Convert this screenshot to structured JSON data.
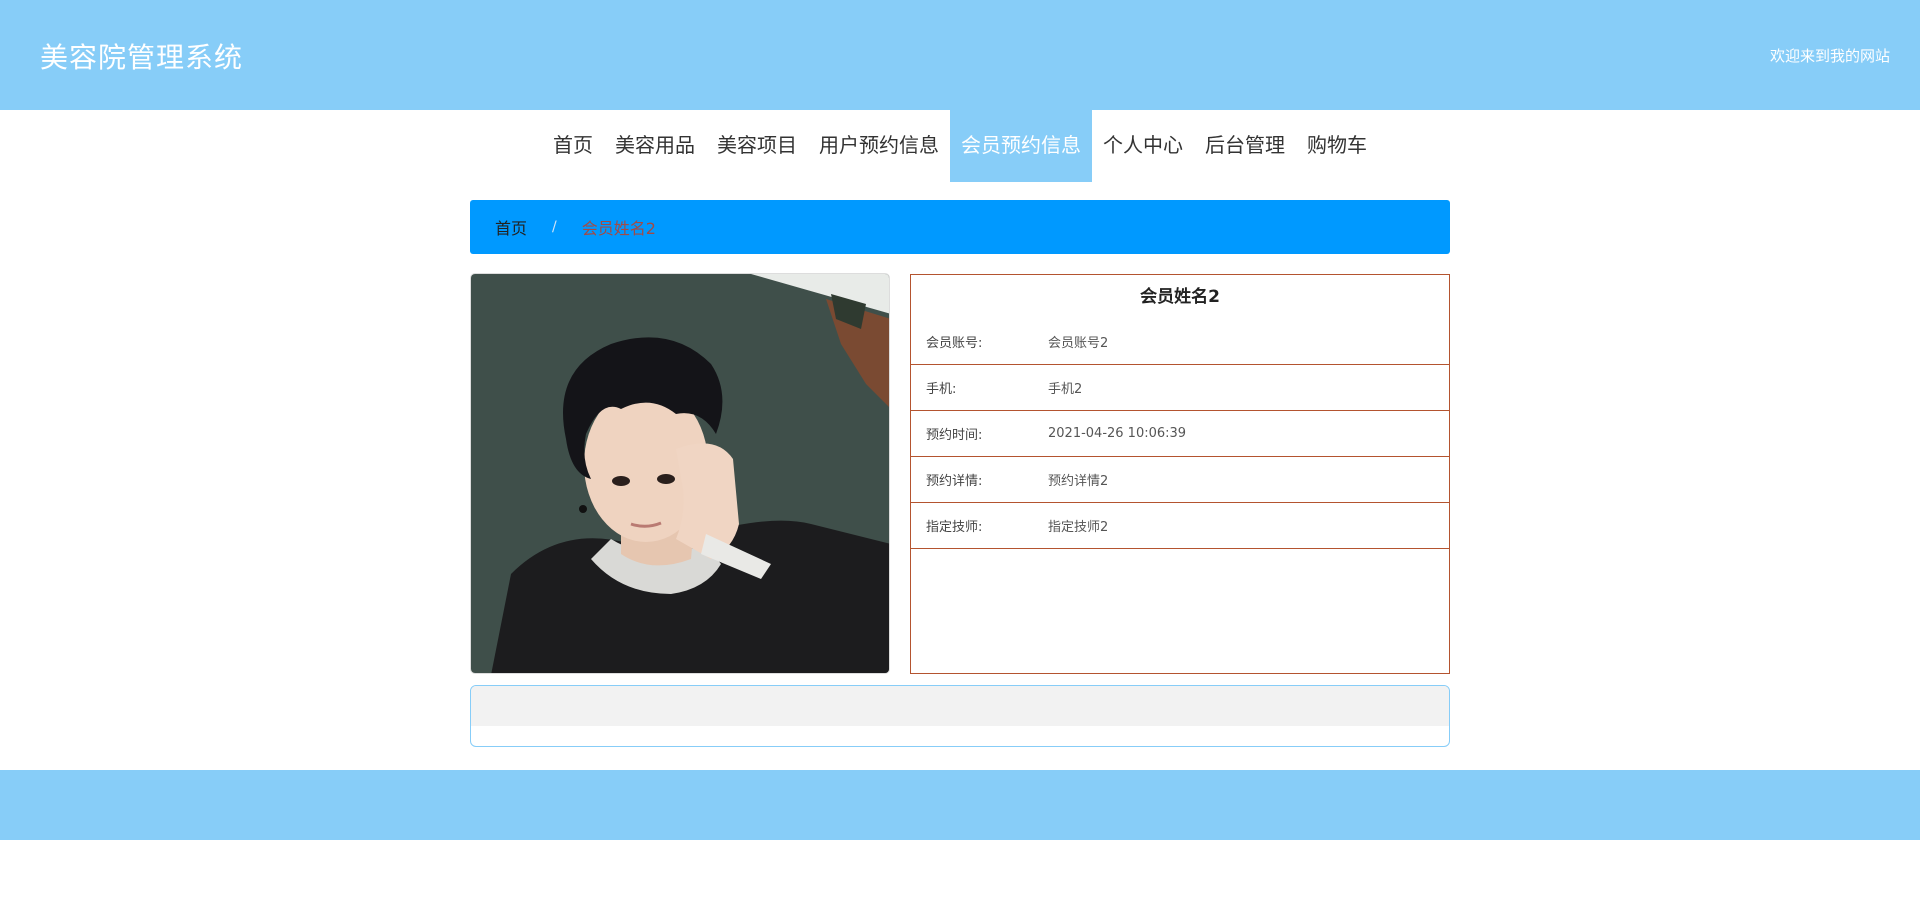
{
  "header": {
    "title": "美容院管理系统",
    "welcome": "欢迎来到我的网站"
  },
  "nav": {
    "items": [
      {
        "label": "首页"
      },
      {
        "label": "美容用品"
      },
      {
        "label": "美容项目"
      },
      {
        "label": "用户预约信息"
      },
      {
        "label": "会员预约信息",
        "active": true
      },
      {
        "label": "个人中心"
      },
      {
        "label": "后台管理"
      },
      {
        "label": "购物车"
      }
    ]
  },
  "breadcrumb": {
    "home": "首页",
    "separator": "/",
    "current": "会员姓名2"
  },
  "detail": {
    "title": "会员姓名2",
    "rows": [
      {
        "label": "会员账号:",
        "value": "会员账号2"
      },
      {
        "label": "手机:",
        "value": "手机2"
      },
      {
        "label": "预约时间:",
        "value": "2021-04-26 10:06:39"
      },
      {
        "label": "预约详情:",
        "value": "预约详情2"
      },
      {
        "label": "指定技师:",
        "value": "指定技师2"
      }
    ]
  },
  "colors": {
    "header_bg": "#87cdf8",
    "breadcrumb_bg": "#0099ff",
    "detail_border": "#b4542f"
  }
}
